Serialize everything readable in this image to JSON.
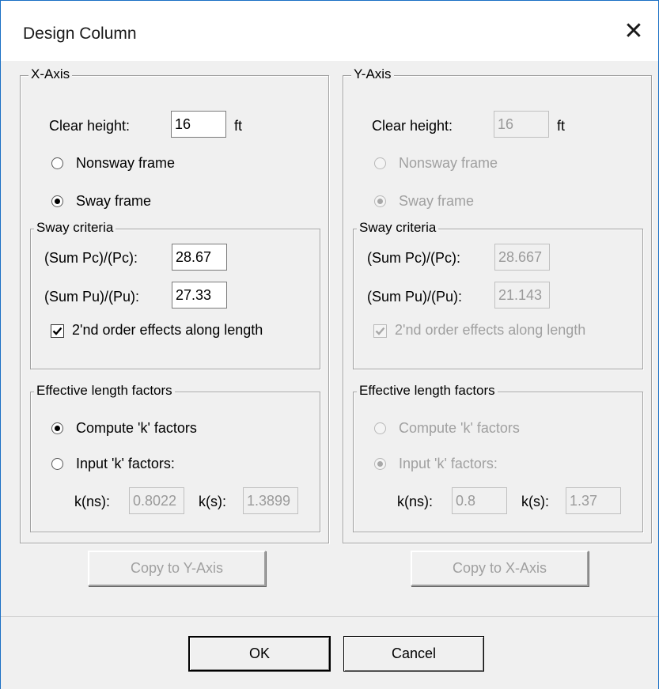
{
  "window": {
    "title": "Design Column",
    "close_glyph": "✕"
  },
  "x_axis": {
    "legend": "X-Axis",
    "clear_height_label": "Clear height:",
    "clear_height_value": "16",
    "clear_height_unit": "ft",
    "nonsway_label": "Nonsway frame",
    "sway_label": "Sway frame",
    "frame_selected": "sway",
    "sway_criteria": {
      "legend": "Sway criteria",
      "sum_pc_label": "(Sum Pc)/(Pc):",
      "sum_pc_value": "28.67",
      "sum_pu_label": "(Sum Pu)/(Pu):",
      "sum_pu_value": "27.33",
      "second_order_label": "2'nd order effects along length",
      "second_order_checked": true
    },
    "effective_length": {
      "legend": "Effective length factors",
      "compute_label": "Compute 'k' factors",
      "input_label": "Input 'k' factors:",
      "selected": "compute",
      "kns_label": "k(ns):",
      "kns_value": "0.8022",
      "ks_label": "k(s):",
      "ks_value": "1.3899"
    },
    "copy_button": "Copy to Y-Axis"
  },
  "y_axis": {
    "legend": "Y-Axis",
    "clear_height_label": "Clear height:",
    "clear_height_value": "16",
    "clear_height_unit": "ft",
    "nonsway_label": "Nonsway frame",
    "sway_label": "Sway frame",
    "frame_selected": "sway",
    "sway_criteria": {
      "legend": "Sway criteria",
      "sum_pc_label": "(Sum Pc)/(Pc):",
      "sum_pc_value": "28.667",
      "sum_pu_label": "(Sum Pu)/(Pu):",
      "sum_pu_value": "21.143",
      "second_order_label": "2'nd order effects along length",
      "second_order_checked": true
    },
    "effective_length": {
      "legend": "Effective length factors",
      "compute_label": "Compute 'k' factors",
      "input_label": "Input 'k' factors:",
      "selected": "input",
      "kns_label": "k(ns):",
      "kns_value": "0.8",
      "ks_label": "k(s):",
      "ks_value": "1.37"
    },
    "copy_button": "Copy to X-Axis"
  },
  "footer": {
    "ok_label": "OK",
    "cancel_label": "Cancel"
  },
  "colors": {
    "window_border": "#1a6fc4",
    "face": "#f0f0f0",
    "disabled_text": "#a0a0a0"
  }
}
